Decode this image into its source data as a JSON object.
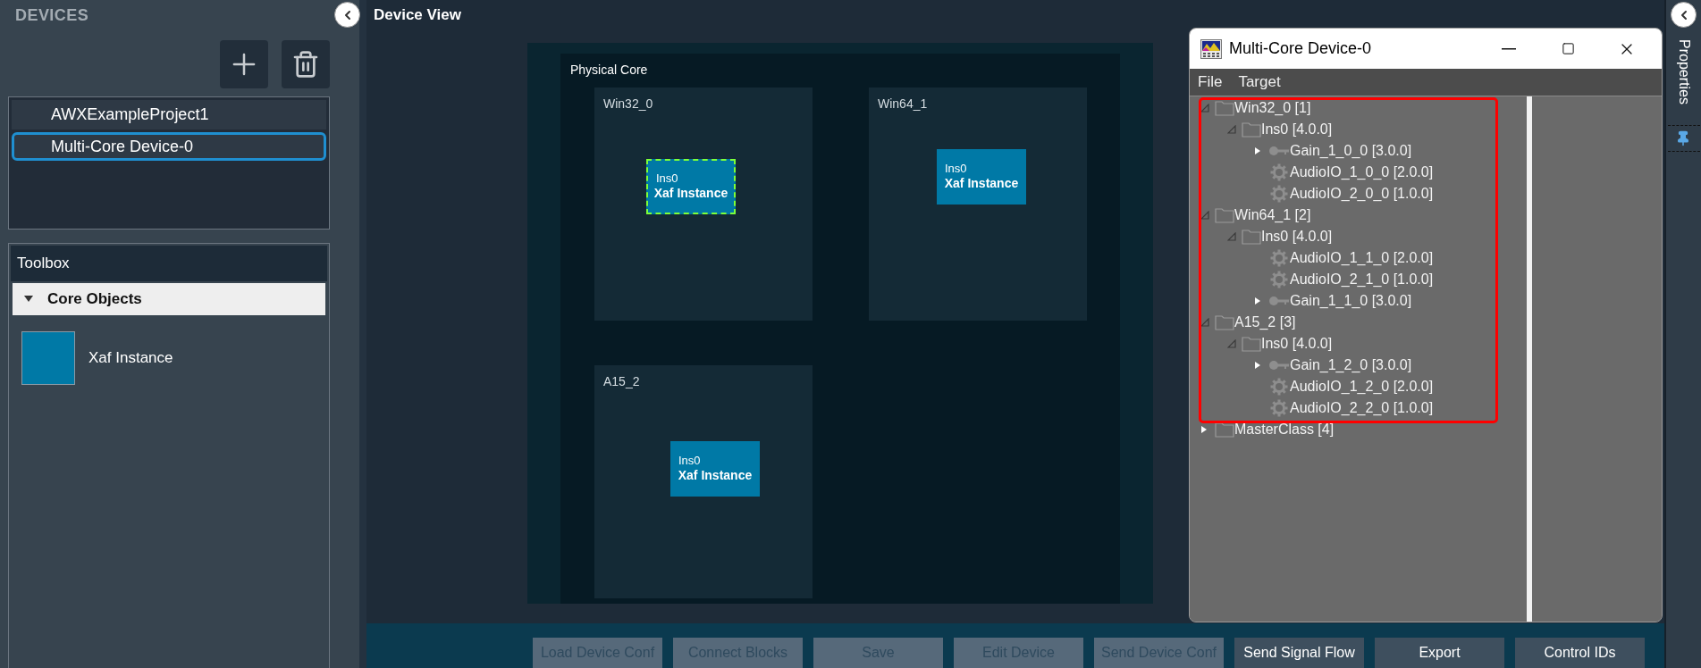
{
  "sidebar": {
    "title": "DEVICES",
    "devices": [
      {
        "label": "AWXExampleProject1",
        "selected": false
      },
      {
        "label": "Multi-Core Device-0",
        "selected": true
      }
    ],
    "toolbox": {
      "title": "Toolbox",
      "category": {
        "label": "Core Objects",
        "expanded": true
      },
      "items": [
        {
          "label": "Xaf Instance"
        }
      ]
    }
  },
  "device_view": {
    "title": "Device View",
    "physical_core_label": "Physical Core",
    "cores": [
      {
        "name": "Win32_0",
        "instance": {
          "id": "Ins0",
          "label": "Xaf Instance",
          "selected": true
        }
      },
      {
        "name": "Win64_1",
        "instance": {
          "id": "Ins0",
          "label": "Xaf Instance",
          "selected": false
        }
      },
      {
        "name": "A15_2",
        "instance": {
          "id": "Ins0",
          "label": "Xaf Instance",
          "selected": false
        }
      }
    ]
  },
  "buttons": [
    {
      "label": "Load Device Conf",
      "disabled": true
    },
    {
      "label": "Connect Blocks",
      "disabled": true
    },
    {
      "label": "Save",
      "disabled": true
    },
    {
      "label": "Edit Device",
      "disabled": true
    },
    {
      "label": "Send Device Conf",
      "disabled": true
    },
    {
      "label": "Send Signal Flow",
      "disabled": false
    },
    {
      "label": "Export",
      "disabled": false
    },
    {
      "label": "Control IDs",
      "disabled": false
    }
  ],
  "properties_tab": {
    "label": "Properties"
  },
  "tree_window": {
    "title": "Multi-Core Device-0",
    "menu": [
      "File",
      "Target"
    ],
    "tree": [
      {
        "label": "Win32_0 [1]",
        "kind": "folder",
        "expanded": true,
        "children": [
          {
            "label": "Ins0 [4.0.0]",
            "kind": "folder",
            "expanded": true,
            "children": [
              {
                "label": "Gain_1_0_0 [3.0.0]",
                "kind": "key",
                "expanded": false
              },
              {
                "label": "AudioIO_1_0_0 [2.0.0]",
                "kind": "gear"
              },
              {
                "label": "AudioIO_2_0_0 [1.0.0]",
                "kind": "gear"
              }
            ]
          }
        ]
      },
      {
        "label": "Win64_1 [2]",
        "kind": "folder",
        "expanded": true,
        "children": [
          {
            "label": "Ins0 [4.0.0]",
            "kind": "folder",
            "expanded": true,
            "children": [
              {
                "label": "AudioIO_1_1_0 [2.0.0]",
                "kind": "gear"
              },
              {
                "label": "AudioIO_2_1_0 [1.0.0]",
                "kind": "gear"
              },
              {
                "label": "Gain_1_1_0 [3.0.0]",
                "kind": "key",
                "expanded": false
              }
            ]
          }
        ]
      },
      {
        "label": "A15_2 [3]",
        "kind": "folder",
        "expanded": true,
        "children": [
          {
            "label": "Ins0 [4.0.0]",
            "kind": "folder",
            "expanded": true,
            "children": [
              {
                "label": "Gain_1_2_0 [3.0.0]",
                "kind": "key",
                "expanded": false
              },
              {
                "label": "AudioIO_1_2_0 [2.0.0]",
                "kind": "gear"
              },
              {
                "label": "AudioIO_2_2_0 [1.0.0]",
                "kind": "gear"
              }
            ]
          }
        ]
      },
      {
        "label": "MasterClass [4]",
        "kind": "folder",
        "expanded": false
      }
    ]
  }
}
